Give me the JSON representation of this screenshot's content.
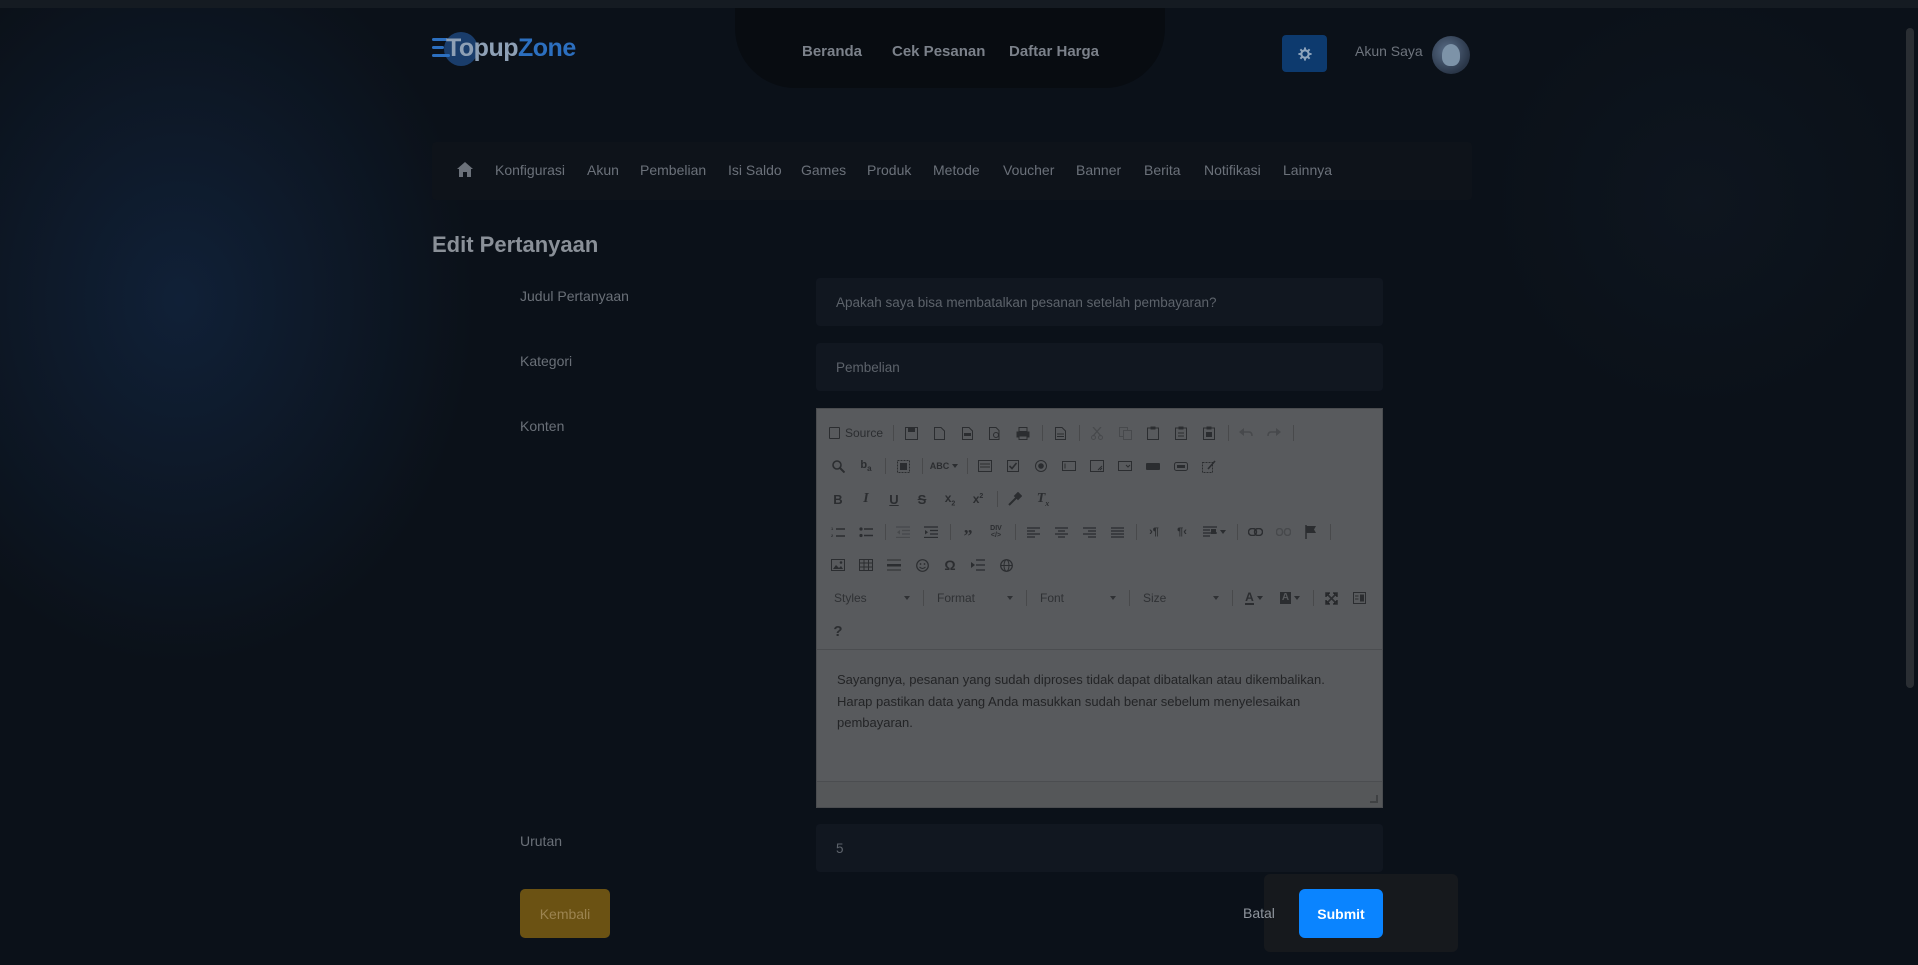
{
  "header": {
    "logo_text_a": "Topup",
    "logo_text_b": "Zone",
    "nav": [
      "Beranda",
      "Cek Pesanan",
      "Daftar Harga"
    ],
    "account_label": "Akun Saya"
  },
  "menu": {
    "items": [
      "Konfigurasi",
      "Akun",
      "Pembelian",
      "Isi Saldo",
      "Games",
      "Produk",
      "Metode",
      "Voucher",
      "Banner",
      "Berita",
      "Notifikasi",
      "Lainnya"
    ]
  },
  "page": {
    "title": "Edit Pertanyaan"
  },
  "form": {
    "title_label": "Judul Pertanyaan",
    "title_value": "Apakah saya bisa membatalkan pesanan setelah pembayaran?",
    "category_label": "Kategori",
    "category_value": "Pembelian",
    "content_label": "Konten",
    "order_label": "Urutan",
    "order_value": "5"
  },
  "editor": {
    "source_label": "Source",
    "combos": [
      "Styles",
      "Format",
      "Font",
      "Size"
    ],
    "help": "?",
    "content_lines": [
      "Sayangnya, pesanan yang sudah diproses tidak dapat dibatalkan atau dikembalikan.",
      "Harap pastikan data yang Anda masukkan sudah benar sebelum menyelesaikan",
      "pembayaran."
    ]
  },
  "actions": {
    "back_label": "Kembali",
    "cancel_label": "Batal",
    "submit_label": "Submit"
  },
  "colors": {
    "primary": "#0a84ff",
    "back_button": "#6b5213",
    "background": "#0b1119"
  }
}
